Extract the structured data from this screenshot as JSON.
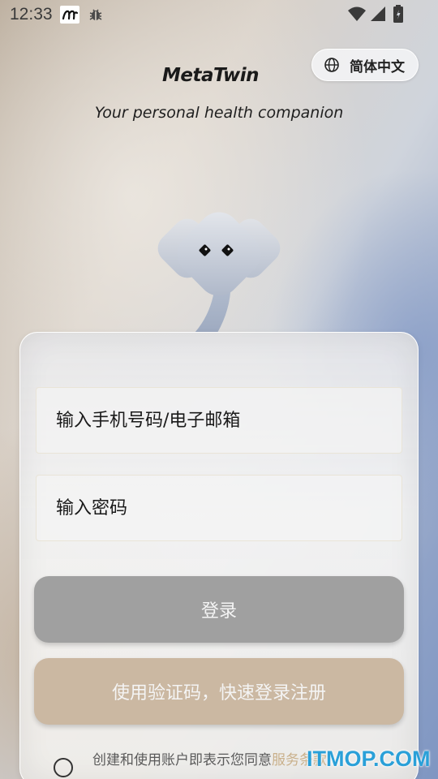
{
  "status_bar": {
    "time": "12:33",
    "icons": [
      "metatwin-app-icon",
      "bug-icon",
      "wifi-icon",
      "signal-icon",
      "battery-icon"
    ]
  },
  "language": {
    "label": "简体中文",
    "icon": "globe-icon"
  },
  "brand": {
    "logo_text": "MetaTwin",
    "tagline": "Your personal health companion"
  },
  "form": {
    "phone_email_placeholder": "输入手机号码/电子邮箱",
    "password_placeholder": "输入密码",
    "login_label": "登录",
    "code_login_label": "使用验证码，快速登录注册"
  },
  "terms": {
    "prefix": "创建和使用账户即表示您同意",
    "link": "服务条款"
  },
  "watermark": "ITMOP.COM",
  "colors": {
    "login_button": "#a0a0a0",
    "code_button": "#cbb8a2",
    "link": "#c9b08a",
    "watermark": "#2aa0d8"
  }
}
